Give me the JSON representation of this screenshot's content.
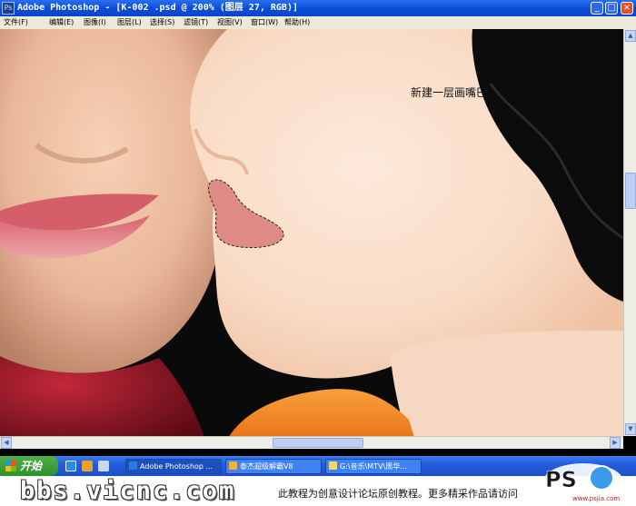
{
  "window": {
    "title": "Adobe Photoshop - [K-002 .psd @ 200% (图层 27, RGB)]",
    "app_icon": "photoshop-icon",
    "controls": [
      "minimize-icon",
      "maximize-icon",
      "close-icon"
    ]
  },
  "menubar": {
    "items": [
      "文件(F)",
      "编辑(E)",
      "图像(I)",
      "图层(L)",
      "选择(S)",
      "滤镜(T)",
      "视图(V)",
      "窗口(W)",
      "帮助(H)"
    ]
  },
  "canvas": {
    "annotation": "新建一层画嘴巴。。",
    "selection_fill": "#dd8b84",
    "skin_color": "#f8dcc6",
    "hair_color": "#0b0b0b"
  },
  "taskbar": {
    "start_label": "开始",
    "quick_launch": [
      "internet-explorer-icon",
      "media-player-icon",
      "desktop-icon"
    ],
    "tasks": [
      {
        "label": "Adobe Photoshop ...",
        "icon": "photoshop-icon",
        "active": true
      },
      {
        "label": "泰杰超级解霸V8",
        "icon": "media-icon",
        "active": false
      },
      {
        "label": "G:\\音乐\\MTV\\周华...",
        "icon": "folder-icon",
        "active": false
      }
    ]
  },
  "footer": {
    "brand": "bbs.vicnc.com",
    "note": "此教程为创意设计论坛原创教程。更多精采作品请访问",
    "logo_text": "PS",
    "logo_sub": "www.psjia.com"
  }
}
